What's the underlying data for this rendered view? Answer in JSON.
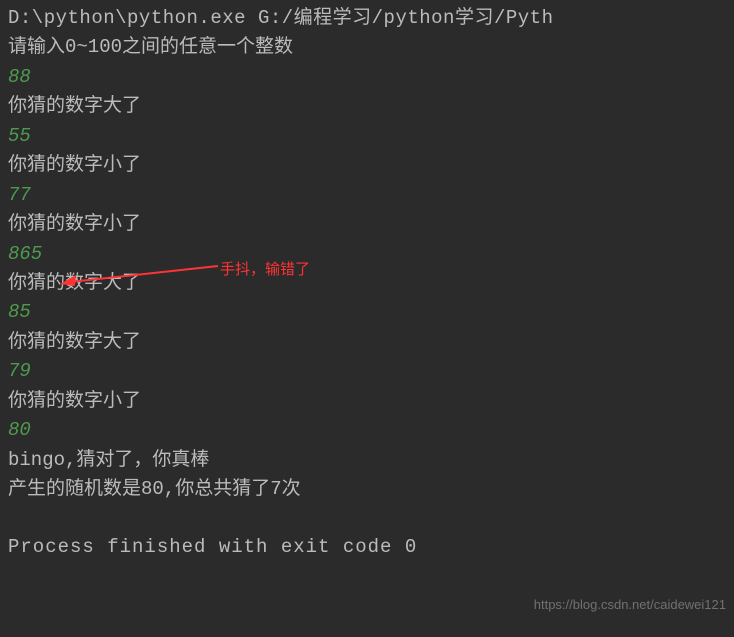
{
  "header": {
    "path": "D:\\python\\python.exe G:/编程学习/python学习/Pyth"
  },
  "prompt": "请输入0~100之间的任意一个整数",
  "interactions": [
    {
      "input": "88",
      "feedback": "你猜的数字大了"
    },
    {
      "input": "55",
      "feedback": "你猜的数字小了"
    },
    {
      "input": "77",
      "feedback": "你猜的数字小了"
    },
    {
      "input": "865",
      "feedback": "你猜的数字大了"
    },
    {
      "input": "85",
      "feedback": "你猜的数字大了"
    },
    {
      "input": "79",
      "feedback": "你猜的数字小了"
    },
    {
      "input": "80",
      "feedback": "bingo,猜对了，你真棒"
    }
  ],
  "result": "产生的随机数是80,你总共猜了7次",
  "exit_message": "Process finished with exit code 0",
  "annotation": {
    "text": "手抖，输错了"
  },
  "watermark": "https://blog.csdn.net/caidewei121"
}
